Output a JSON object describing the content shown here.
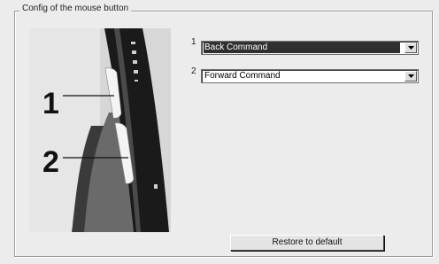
{
  "group": {
    "title": "Config of the mouse button"
  },
  "illustration": {
    "callout_1": "1",
    "callout_2": "2"
  },
  "buttons_config": [
    {
      "number": "1",
      "value": "Back Command",
      "selected": true
    },
    {
      "number": "2",
      "value": "Forward Command",
      "selected": false
    }
  ],
  "actions": {
    "restore_label": "Restore to default"
  },
  "icons": {
    "dropdown": "chevron-down-icon"
  },
  "colors": {
    "panel_bg": "#ececec",
    "selected_bg": "#2f2f2f",
    "mouse_body": "#1a1a1a"
  }
}
